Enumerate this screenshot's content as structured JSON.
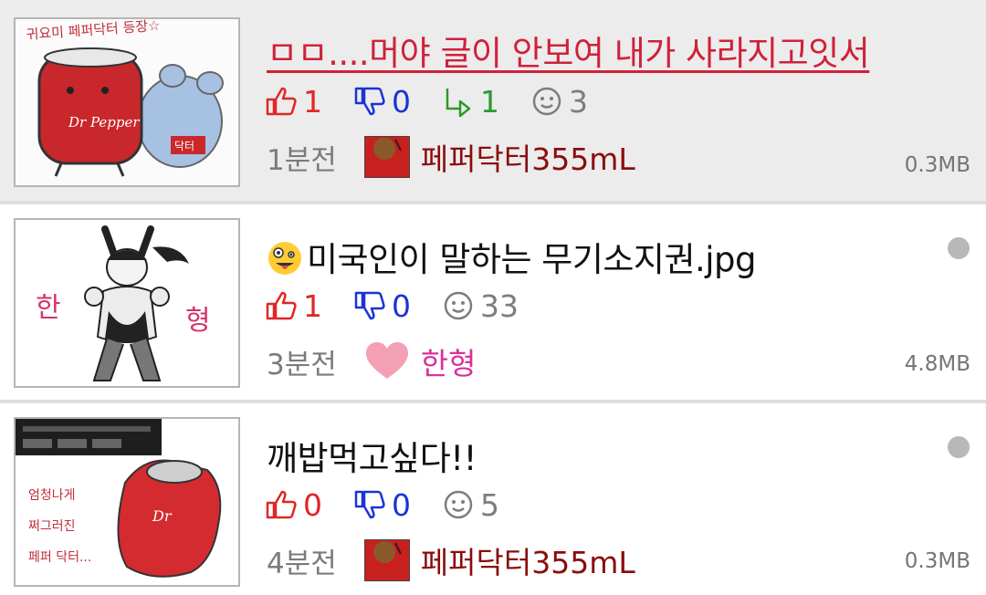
{
  "posts": [
    {
      "title": "ㅁㅁ....머야 글이 안보여 내가 사라지고잇서",
      "upvotes": "1",
      "downvotes": "0",
      "shares": "1",
      "comments": "3",
      "time": "1분전",
      "author": "페퍼닥터355mL",
      "size": "0.3MB",
      "thumb_text": [
        "귀요미 페퍼닥터 등장☆",
        "Dr Pepper",
        "닥터"
      ]
    },
    {
      "title_emoji": "zany-face-icon",
      "title": "미국인이 말하는 무기소지권.jpg",
      "upvotes": "1",
      "downvotes": "0",
      "comments": "33",
      "time": "3분전",
      "author": "한형",
      "size": "4.8MB",
      "thumb_text": [
        "한",
        "형"
      ]
    },
    {
      "title": "깨밥먹고싶다!!",
      "upvotes": "0",
      "downvotes": "0",
      "comments": "5",
      "time": "4분전",
      "author": "페퍼닥터355mL",
      "size": "0.3MB",
      "thumb_text": [
        "엄청나게",
        "쩌그러진",
        "페퍼 닥터...",
        "Dr"
      ]
    }
  ],
  "colors": {
    "selected_bg": "#ececec",
    "title_link": "#d0213a",
    "upvote": "#e02626",
    "downvote": "#1a33d6",
    "share": "#2c9a2c",
    "author": "#8a0d0d",
    "author_pink": "#d8329c",
    "unread_dot": "#b8b8b8"
  }
}
